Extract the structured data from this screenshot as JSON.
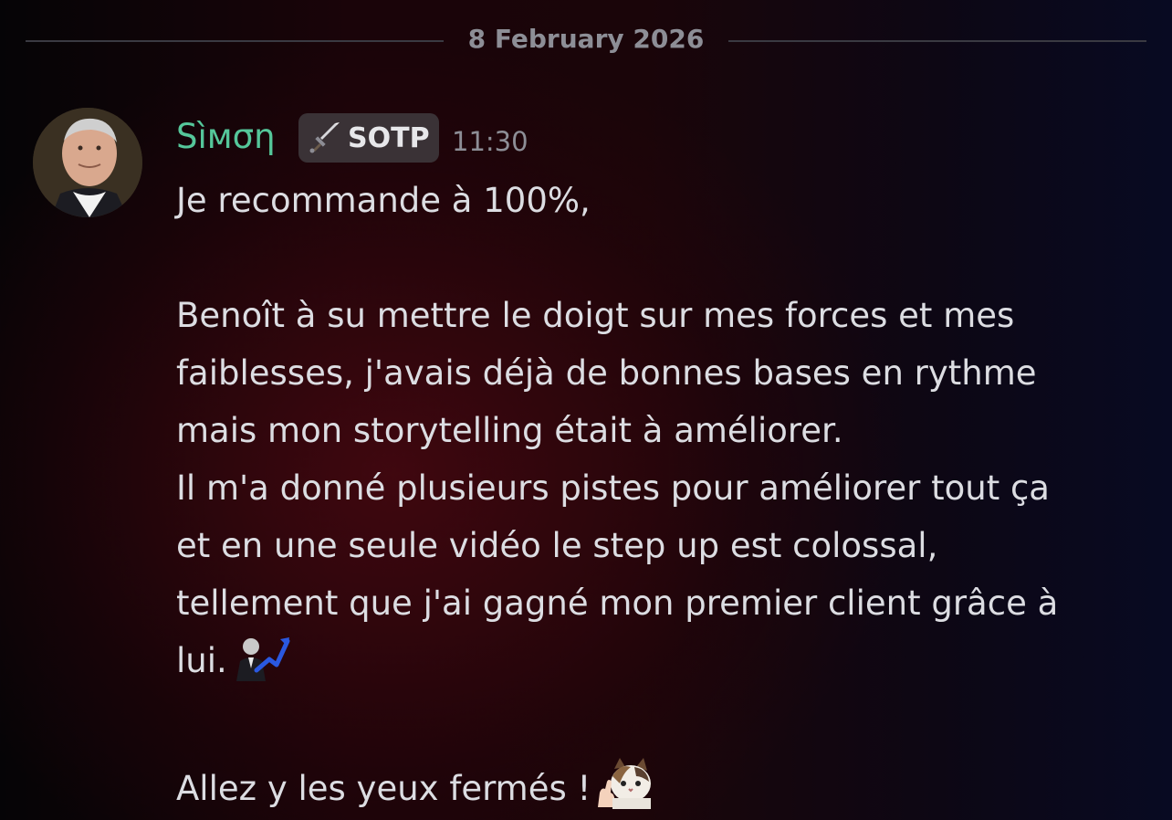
{
  "divider": {
    "date": "8 February 2026"
  },
  "author": {
    "name": "Sìмση",
    "role_tag": "SOTP",
    "role_icon": "sword-icon",
    "name_color": "#55c79a",
    "timestamp": "11:30"
  },
  "message": {
    "line1": "Je recommande à 100%,",
    "line2": "Benoît à su mettre le doigt sur mes forces et mes",
    "line3": "faiblesses, j'avais déjà de bonnes bases en rythme",
    "line4": "mais mon storytelling était à améliorer.",
    "line5": "Il m'a donné plusieurs pistes pour améliorer tout ça",
    "line6": "et en une seule vidéo le step up est colossal,",
    "line7": "tellement que j'ai gagné mon premier client grâce à",
    "line8": "lui.",
    "line9": "Allez y les yeux fermés !",
    "emoji1": "stonks-emoji-icon",
    "emoji2": "cat-thumbs-up-emoji-icon"
  }
}
